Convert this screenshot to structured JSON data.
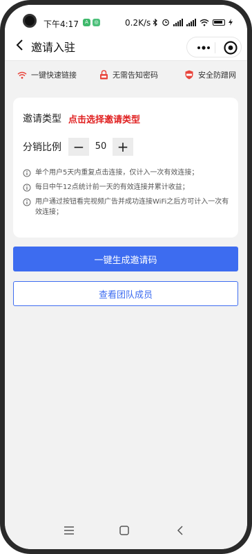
{
  "status_bar": {
    "time": "下午4:17",
    "network_speed": "0.2K/s",
    "icons": [
      "app-badge-icon",
      "app-badge-icon",
      "bluetooth-icon",
      "alarm-icon",
      "signal-icon",
      "hd-signal-icon",
      "wifi-icon",
      "battery-icon"
    ]
  },
  "nav": {
    "title": "邀请入驻"
  },
  "features": [
    {
      "label": "一键快速链接",
      "icon": "wifi-icon"
    },
    {
      "label": "无需告知密码",
      "icon": "lock-icon"
    },
    {
      "label": "安全防蹭网",
      "icon": "sos-shield-icon"
    }
  ],
  "form": {
    "type_label": "邀请类型",
    "type_action": "点击选择邀请类型",
    "ratio_label": "分销比例",
    "ratio_value": "50",
    "minus": "−",
    "plus": "+"
  },
  "notes": [
    "单个用户5天内重复点击连接，仅计入一次有效连接；",
    "每日中午12点统计前一天的有效连接并累计收益；",
    "用户通过按钮看完视频广告并成功连接WiFi之后方可计入一次有效连接；"
  ],
  "buttons": {
    "generate": "一键生成邀请码",
    "team": "查看团队成员"
  },
  "colors": {
    "primary": "#3d6cf0",
    "accent_red": "#e02020",
    "icon_red": "#e8453c"
  }
}
